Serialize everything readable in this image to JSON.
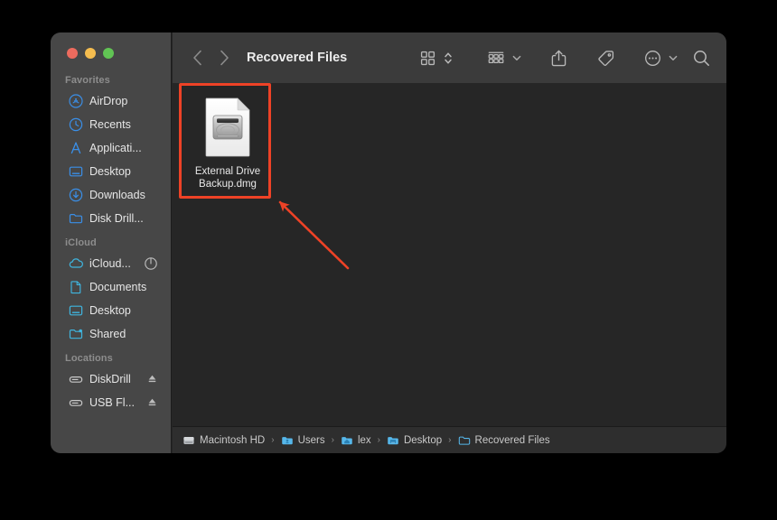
{
  "window": {
    "title": "Recovered Files",
    "traffic_lights": [
      {
        "name": "close",
        "color": "#ED6B5E"
      },
      {
        "name": "minimize",
        "color": "#F5BD4F"
      },
      {
        "name": "maximize",
        "color": "#61C454"
      }
    ]
  },
  "toolbar": {
    "back_label": "‹",
    "forward_label": "›",
    "title": "Recovered Files",
    "icons": [
      "back-icon",
      "forward-icon",
      "view-grid-icon",
      "view-stepper-icon",
      "group-by-icon",
      "share-icon",
      "tag-icon",
      "more-actions-icon",
      "search-icon"
    ]
  },
  "sidebar": {
    "groups": [
      {
        "header": "Favorites",
        "items": [
          {
            "label": "AirDrop",
            "icon": "airdrop-icon",
            "color": "#3a8fe8",
            "trailing": ""
          },
          {
            "label": "Recents",
            "icon": "clock-icon",
            "color": "#3a8fe8",
            "trailing": ""
          },
          {
            "label": "Applicati...",
            "icon": "applications-icon",
            "color": "#3a8fe8",
            "trailing": ""
          },
          {
            "label": "Desktop",
            "icon": "desktop-icon",
            "color": "#3a8fe8",
            "trailing": ""
          },
          {
            "label": "Downloads",
            "icon": "downloads-icon",
            "color": "#3a8fe8",
            "trailing": ""
          },
          {
            "label": "Disk Drill...",
            "icon": "folder-icon",
            "color": "#3a8fe8",
            "trailing": ""
          }
        ]
      },
      {
        "header": "iCloud",
        "items": [
          {
            "label": "iCloud...",
            "icon": "icloud-icon",
            "color": "#3fb6e0",
            "trailing": "sync-progress-icon"
          },
          {
            "label": "Documents",
            "icon": "document-icon",
            "color": "#3fb6e0",
            "trailing": ""
          },
          {
            "label": "Desktop",
            "icon": "desktop-icon",
            "color": "#3fb6e0",
            "trailing": ""
          },
          {
            "label": "Shared",
            "icon": "shared-folder-icon",
            "color": "#3fb6e0",
            "trailing": ""
          }
        ]
      },
      {
        "header": "Locations",
        "items": [
          {
            "label": "DiskDrill",
            "icon": "external-drive-icon",
            "color": "#c9c9c9",
            "trailing": "eject-icon"
          },
          {
            "label": "USB Fl...",
            "icon": "external-drive-icon",
            "color": "#c9c9c9",
            "trailing": "eject-icon"
          }
        ]
      }
    ]
  },
  "files": [
    {
      "name": "External Drive Backup.dmg",
      "name_line1": "External Drive",
      "name_line2": "Backup.dmg",
      "icon": "dmg-disk-image-icon",
      "selected": true
    }
  ],
  "annotation": {
    "highlight_color": "#EE4226",
    "arrow_color": "#EE4226",
    "target": "External Drive Backup.dmg"
  },
  "path_bar": {
    "crumbs": [
      {
        "label": "Macintosh HD",
        "icon": "hard-drive-icon"
      },
      {
        "label": "Users",
        "icon": "users-folder-icon"
      },
      {
        "label": "lex",
        "icon": "home-folder-icon"
      },
      {
        "label": "Desktop",
        "icon": "desktop-folder-icon"
      },
      {
        "label": "Recovered Files",
        "icon": "folder-icon"
      }
    ],
    "separator": "›"
  }
}
